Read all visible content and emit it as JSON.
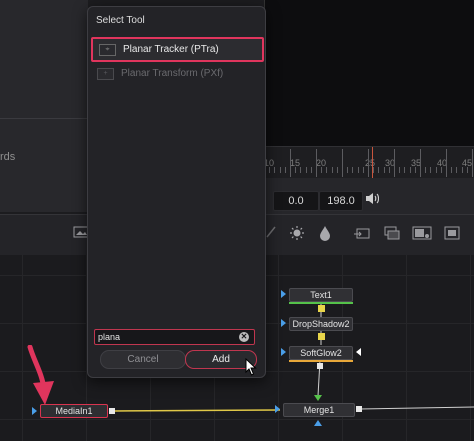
{
  "left_panel": {
    "partial_label": "rds"
  },
  "timeline": {
    "tick_labels": [
      "10",
      "15",
      "20",
      "25",
      "30",
      "35",
      "40",
      "45"
    ],
    "start_frame": "0.0",
    "end_frame": "198.0"
  },
  "dialog": {
    "title": "Select Tool",
    "tools": [
      {
        "label": "Planar Tracker (PTra)",
        "state": "selected"
      },
      {
        "label": "Planar Transform (PXf)",
        "state": "disabled"
      }
    ],
    "search": {
      "value": "plana"
    },
    "cancel_label": "Cancel",
    "add_label": "Add"
  },
  "nodes": {
    "text": "Text1",
    "dropshadow": "DropShadow2",
    "softglow": "SoftGlow2",
    "merge": "Merge1",
    "mediain": "MediaIn1"
  },
  "colors": {
    "highlight": "#e0355d",
    "link_yellow": "#e8d54a",
    "port_blue": "#4a9ee8",
    "port_green": "#55c24a"
  },
  "icons": [
    "speaker-icon",
    "clear-icon",
    "tracker-icon",
    "transform-icon",
    "annotation-arrow-icon",
    "mouse-cursor-icon"
  ]
}
